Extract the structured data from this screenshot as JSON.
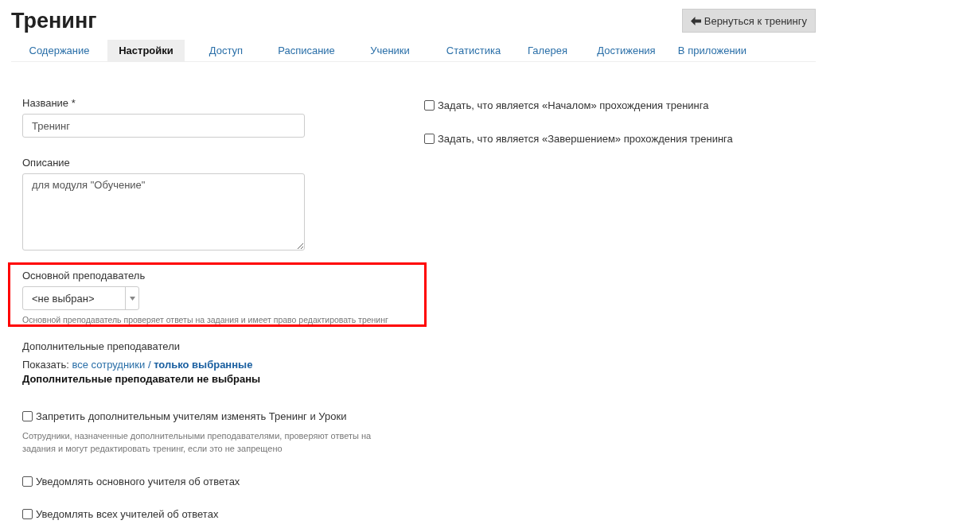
{
  "title": "Тренинг",
  "back_button": "Вернуться к тренингу",
  "tabs": [
    {
      "label": "Содержание",
      "selected": false
    },
    {
      "label": "Настройки",
      "selected": true
    },
    {
      "label": "Доступ",
      "selected": false
    },
    {
      "label": "Расписание",
      "selected": false
    },
    {
      "label": "Ученики",
      "selected": false
    },
    {
      "label": "Статистика",
      "selected": false
    },
    {
      "label": "Галерея",
      "selected": false
    },
    {
      "label": "Достижения",
      "selected": false
    },
    {
      "label": "В приложении",
      "selected": false
    }
  ],
  "name_field": {
    "label": "Название *",
    "value": "Тренинг"
  },
  "description_field": {
    "label": "Описание",
    "value": "для модуля \"Обучение\""
  },
  "main_teacher": {
    "label": "Основной преподаватель",
    "value": "<не выбран>",
    "hint": "Основной преподаватель проверяет ответы на задания и имеет право редактировать тренинг",
    "highlighted": true
  },
  "extra_teachers": {
    "label": "Дополнительные преподаватели",
    "show_label": "Показать:",
    "separator": "/",
    "filters": [
      {
        "label": "все сотрудники",
        "selected": false
      },
      {
        "label": "только выбранные",
        "selected": true
      }
    ],
    "empty_text": "Дополнительные преподаватели не выбраны"
  },
  "left_checks": [
    {
      "label": "Запретить дополнительным учителям изменять Тренинг и Уроки",
      "checked": false,
      "hint": "Сотрудники, назначенные дополнительными преподавателями, проверяют ответы на задания и могут редактировать тренинг, если это не запрещено"
    },
    {
      "label": "Уведомлять основного учителя об ответах",
      "checked": false
    },
    {
      "label": "Уведомлять всех учителей об ответах",
      "checked": false
    }
  ],
  "right_checks": [
    {
      "label": "Задать, что является «Началом» прохождения тренинга",
      "checked": false
    },
    {
      "label": "Задать, что является «Завершением» прохождения тренинга",
      "checked": false
    }
  ]
}
